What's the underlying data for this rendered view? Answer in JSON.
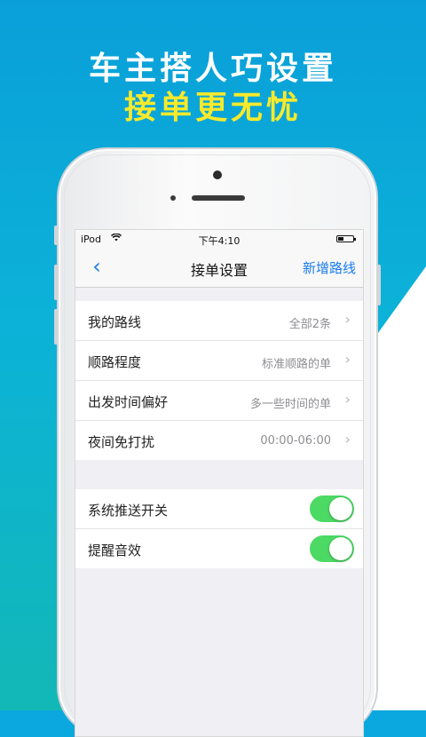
{
  "promo": {
    "headline": "车主搭人巧设置",
    "subline": "接单更无忧"
  },
  "statusbar": {
    "carrier": "iPod",
    "time": "下午4:10"
  },
  "navbar": {
    "back_icon": "‹",
    "title": "接单设置",
    "right_action": "新增路线"
  },
  "settings": {
    "rows": [
      {
        "label": "我的路线",
        "value": "全部2条"
      },
      {
        "label": "顺路程度",
        "value": "标准顺路的单"
      },
      {
        "label": "出发时间偏好",
        "value": "多一些时间的单"
      },
      {
        "label": "夜间免打扰",
        "value": "00:00-06:00"
      }
    ],
    "toggles": [
      {
        "label": "系统推送开关",
        "on": true
      },
      {
        "label": "提醒音效",
        "on": true
      }
    ]
  },
  "icons": {
    "chevron": "›",
    "wifi": "wifi-icon"
  },
  "colors": {
    "accent_blue": "#1a7cf0",
    "toggle_green": "#4cd964",
    "subline_yellow": "#f7ea2b"
  }
}
